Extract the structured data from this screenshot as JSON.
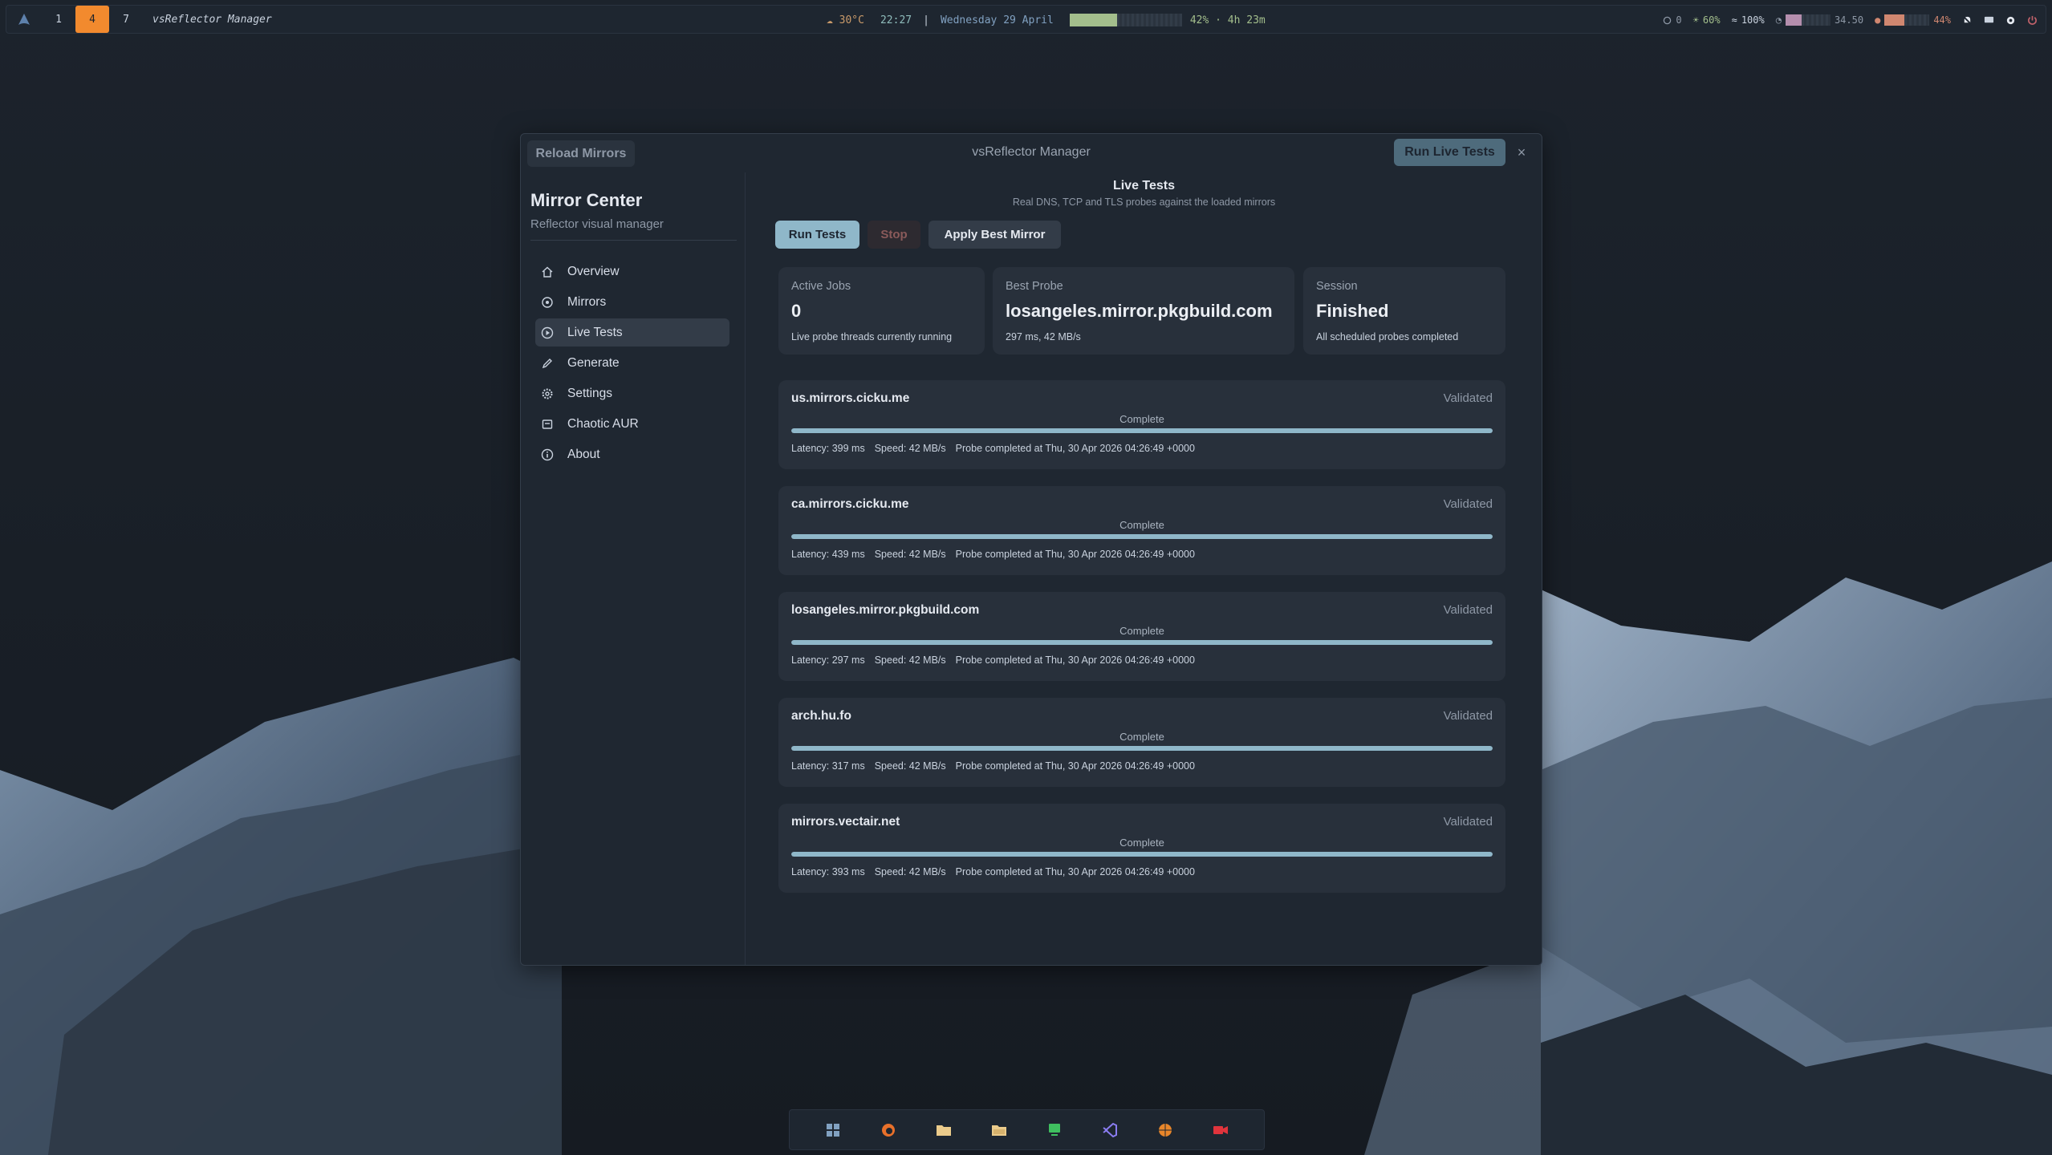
{
  "topbar": {
    "workspaces": [
      "1",
      "4",
      "7"
    ],
    "active_workspace": "4",
    "window_title": "vsReflector Manager",
    "weather": "☁ 30°C",
    "time": "22:27",
    "separator": "|",
    "date": "Wednesday 29 April",
    "battery_level": 0.42,
    "battery_text": "42% · 4h 23m",
    "status": {
      "updates": "0",
      "brightness": "60%",
      "wifi": "100%",
      "memory_value": "34.50",
      "memory_level": 0.35,
      "cpu_text": "44%",
      "cpu_level": 0.44
    }
  },
  "window": {
    "title": "vsReflector Manager",
    "reload_label": "Reload Mirrors",
    "run_live_label": "Run Live Tests",
    "close_glyph": "×"
  },
  "sidebar": {
    "title": "Mirror Center",
    "subtitle": "Reflector visual manager",
    "items": [
      {
        "label": "Overview",
        "icon": "home-icon"
      },
      {
        "label": "Mirrors",
        "icon": "broadcast-icon"
      },
      {
        "label": "Live Tests",
        "icon": "play-circle-icon",
        "active": true
      },
      {
        "label": "Generate",
        "icon": "pencil-icon"
      },
      {
        "label": "Settings",
        "icon": "gear-icon"
      },
      {
        "label": "Chaotic AUR",
        "icon": "package-icon"
      },
      {
        "label": "About",
        "icon": "info-icon"
      }
    ]
  },
  "main": {
    "title": "Live Tests",
    "subtitle": "Real DNS, TCP and TLS probes against the loaded mirrors",
    "actions": {
      "run": "Run Tests",
      "stop": "Stop",
      "apply": "Apply Best Mirror"
    },
    "stats": [
      {
        "label": "Active Jobs",
        "value": "0",
        "note": "Live probe threads currently running"
      },
      {
        "label": "Best Probe",
        "value": "losangeles.mirror.pkgbuild.com",
        "note": "297 ms, 42 MB/s"
      },
      {
        "label": "Session",
        "value": "Finished",
        "note": "All scheduled probes completed"
      }
    ],
    "probes": [
      {
        "host": "us.mirrors.cicku.me",
        "badge": "Validated",
        "state": "Complete",
        "progress": 1.0,
        "latency": "Latency: 399 ms",
        "speed": "Speed: 42 MB/s",
        "completed": "Probe completed at Thu, 30 Apr 2026 04:26:49 +0000"
      },
      {
        "host": "ca.mirrors.cicku.me",
        "badge": "Validated",
        "state": "Complete",
        "progress": 1.0,
        "latency": "Latency: 439 ms",
        "speed": "Speed: 42 MB/s",
        "completed": "Probe completed at Thu, 30 Apr 2026 04:26:49 +0000"
      },
      {
        "host": "losangeles.mirror.pkgbuild.com",
        "badge": "Validated",
        "state": "Complete",
        "progress": 1.0,
        "latency": "Latency: 297 ms",
        "speed": "Speed: 42 MB/s",
        "completed": "Probe completed at Thu, 30 Apr 2026 04:26:49 +0000"
      },
      {
        "host": "arch.hu.fo",
        "badge": "Validated",
        "state": "Complete",
        "progress": 1.0,
        "latency": "Latency: 317 ms",
        "speed": "Speed: 42 MB/s",
        "completed": "Probe completed at Thu, 30 Apr 2026 04:26:49 +0000"
      },
      {
        "host": "mirrors.vectair.net",
        "badge": "Validated",
        "state": "Complete",
        "progress": 1.0,
        "latency": "Latency: 393 ms",
        "speed": "Speed: 42 MB/s",
        "completed": "Probe completed at Thu, 30 Apr 2026 04:26:49 +0000"
      }
    ]
  },
  "dock": {
    "apps": [
      "grid-launcher-icon",
      "firefox-icon",
      "folder-icon",
      "folder-open-icon",
      "monitor-icon",
      "vscode-icon",
      "basketball-icon",
      "camera-recorder-icon"
    ]
  },
  "colors": {
    "accent": "#8fb7c9",
    "workspace_active": "#f28a2e",
    "battery": "#a3be8c",
    "panel": "#1f2731",
    "card": "#28303b"
  }
}
